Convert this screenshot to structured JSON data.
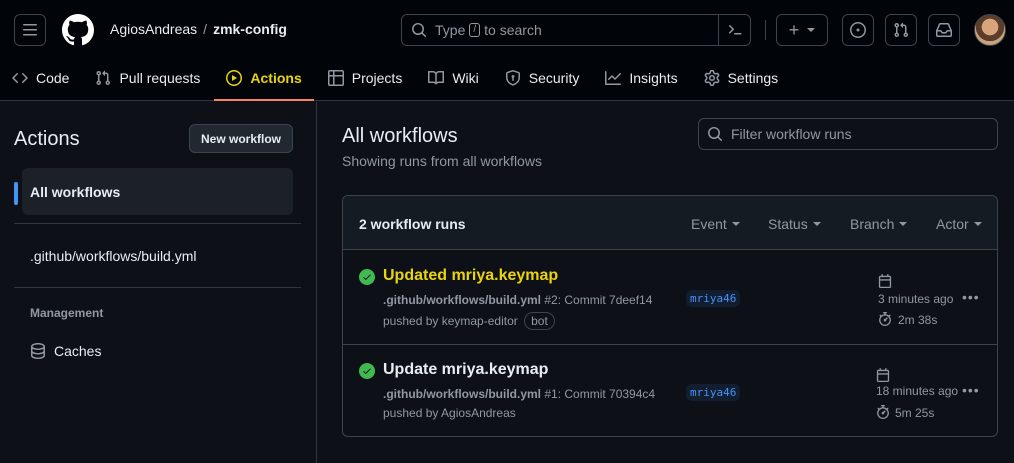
{
  "header": {
    "owner": "AgiosAndreas",
    "separator": "/",
    "repo": "zmk-config",
    "search_placeholder_pre": "Type",
    "search_key": "/",
    "search_placeholder_post": "to search",
    "plus_label": "+"
  },
  "tabs": [
    {
      "label": "Code",
      "icon": "code-icon"
    },
    {
      "label": "Pull requests",
      "icon": "git-pull-request-icon"
    },
    {
      "label": "Actions",
      "icon": "play-icon",
      "active": true
    },
    {
      "label": "Projects",
      "icon": "table-icon"
    },
    {
      "label": "Wiki",
      "icon": "book-icon"
    },
    {
      "label": "Security",
      "icon": "shield-icon"
    },
    {
      "label": "Insights",
      "icon": "graph-icon"
    },
    {
      "label": "Settings",
      "icon": "gear-icon"
    }
  ],
  "sidebar": {
    "title": "Actions",
    "new_workflow": "New workflow",
    "all_workflows": "All workflows",
    "workflow_file": ".github/workflows/build.yml",
    "management_label": "Management",
    "caches": "Caches"
  },
  "main": {
    "title": "All workflows",
    "subtitle": "Showing runs from all workflows",
    "filter_placeholder": "Filter workflow runs",
    "runs_count": "2 workflow runs",
    "filters": [
      "Event",
      "Status",
      "Branch",
      "Actor"
    ]
  },
  "runs": [
    {
      "title": "Updated mriya.keymap",
      "workflow": ".github/workflows/build.yml",
      "run_info": "#2: Commit 7deef14",
      "pushed_by": "pushed by keymap-editor",
      "badge": "bot",
      "branch": "mriya46",
      "time_ago": "3 minutes ago",
      "duration": "2m 38s",
      "more": "•••"
    },
    {
      "title": "Update mriya.keymap",
      "workflow": ".github/workflows/build.yml",
      "run_info": "#1: Commit 70394c4",
      "pushed_by": "pushed by AgiosAndreas",
      "badge": "",
      "branch": "mriya46",
      "time_ago": "18 minutes ago",
      "duration": "5m 25s",
      "more": "•••"
    }
  ],
  "colors": {
    "accent_yellow": "#ebd40c",
    "success_green": "#3fb950",
    "link_blue": "#4493f8",
    "tab_underline": "#f78166"
  }
}
